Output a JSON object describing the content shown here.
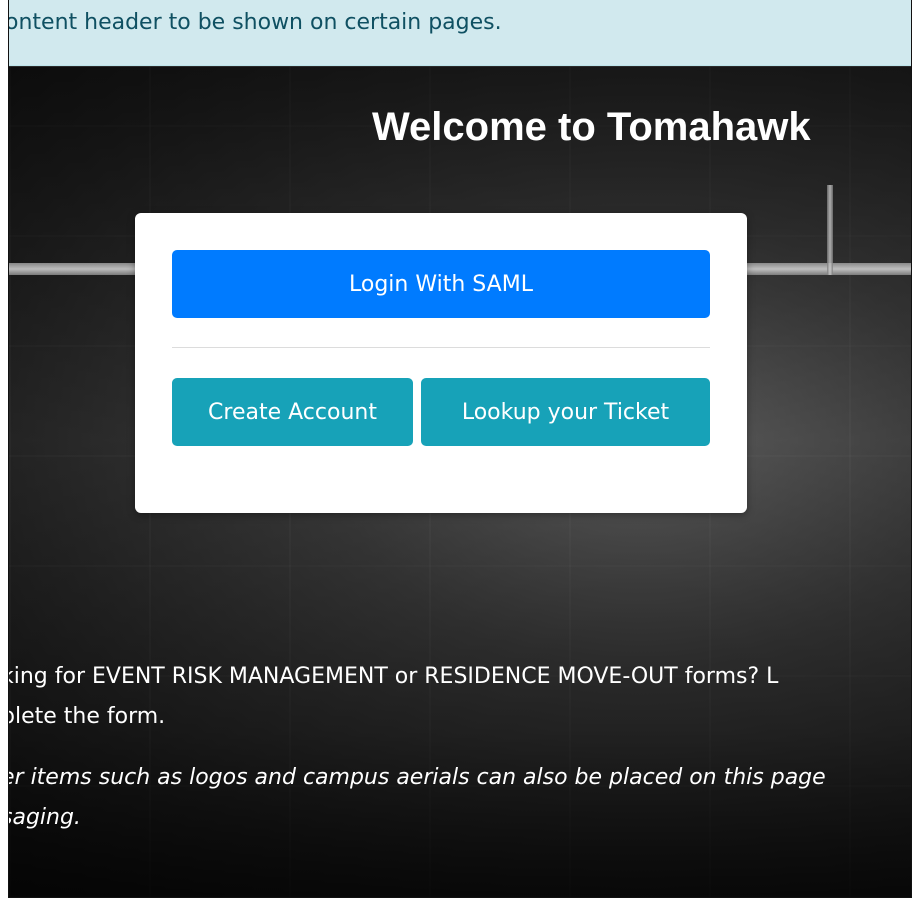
{
  "banner": {
    "text": "ontent header to be shown on certain pages."
  },
  "hero": {
    "title": "Welcome to Tomahawk"
  },
  "login_card": {
    "saml_button_label": "Login With SAML",
    "create_account_label": "Create Account",
    "lookup_ticket_label": "Lookup your Ticket"
  },
  "body_text": {
    "line1": "king for EVENT RISK MANAGEMENT or RESIDENCE MOVE-OUT forms? L",
    "line2": "plete the form.",
    "italic_line1": "er items such as logos and campus aerials can also be placed on this page",
    "italic_line2": "saging."
  },
  "colors": {
    "banner_bg": "#d1e9ee",
    "primary_button": "#007bff",
    "secondary_button": "#17a2b8"
  }
}
